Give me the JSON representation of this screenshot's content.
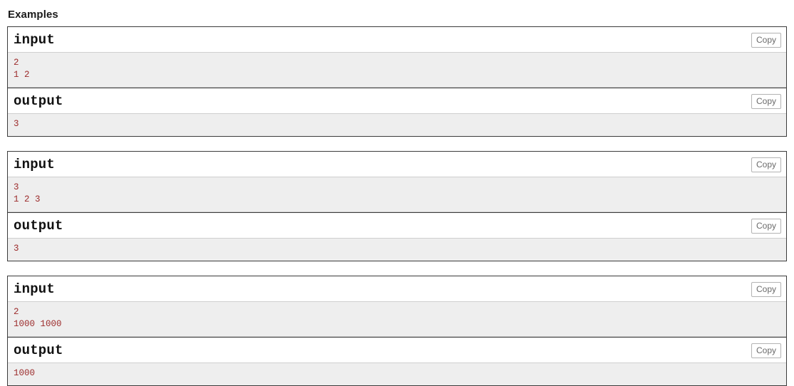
{
  "section": {
    "title": "Examples"
  },
  "labels": {
    "input": "input",
    "output": "output",
    "copy": "Copy"
  },
  "colors": {
    "data_text": "#9c2b2b",
    "data_background": "#eeeeee",
    "block_border": "#3b3b3b",
    "copy_border": "#b3b3b3",
    "copy_text": "#6b6b6b"
  },
  "examples": [
    {
      "input_label": "input",
      "output_label": "output",
      "copy_label": "Copy",
      "input_text": "2\n1 2",
      "output_text": "3"
    },
    {
      "input_label": "input",
      "output_label": "output",
      "copy_label": "Copy",
      "input_text": "3\n1 2 3",
      "output_text": "3"
    },
    {
      "input_label": "input",
      "output_label": "output",
      "copy_label": "Copy",
      "input_text": "2\n1000 1000",
      "output_text": "1000"
    }
  ]
}
